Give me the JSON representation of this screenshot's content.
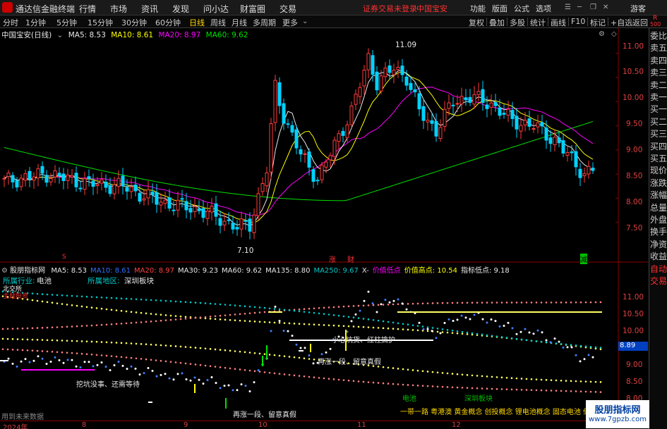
{
  "app": {
    "title": "通达信金融终端",
    "menu": [
      "行情",
      "市场",
      "资讯",
      "发现",
      "问小达",
      "财富圈",
      "交易"
    ],
    "warning": "证券交易未登录",
    "stock_name": "中国宝安",
    "right_menu": [
      "功能",
      "版面",
      "公式",
      "选项"
    ],
    "user": "游客"
  },
  "toolbar": {
    "periods": [
      "分时",
      "1分钟",
      "5分钟",
      "15分钟",
      "30分钟",
      "60分钟",
      "日线",
      "周线",
      "月线",
      "多周期",
      "更多"
    ],
    "active": "日线",
    "right": [
      "复权",
      "叠加",
      "多股",
      "统计",
      "画线",
      "F10",
      "标记",
      "+自选",
      "返回"
    ]
  },
  "main_chart": {
    "title": "中国宝安(日线)",
    "ma": [
      {
        "label": "MA5: 8.53",
        "color": "#e8e8e8"
      },
      {
        "label": "MA10: 8.61",
        "color": "#ffff00"
      },
      {
        "label": "MA20: 8.97",
        "color": "#ff00ff"
      },
      {
        "label": "MA60: 9.62",
        "color": "#00e000"
      }
    ],
    "high_label": "11.09",
    "low_label": "7.10",
    "markers": [
      "S",
      "涨",
      "财",
      "减"
    ]
  },
  "chart_data": {
    "type": "candlestick",
    "ylim": [
      7.0,
      11.3
    ],
    "yticks": [
      11.0,
      10.5,
      10.0,
      9.5,
      9.0,
      8.5,
      8.0,
      7.5
    ],
    "ytick_labels": [
      "11.00",
      "10.50",
      "10.00",
      "9.50",
      "9.00",
      "8.50",
      "8.00",
      "7.50"
    ],
    "high": 11.09,
    "low": 7.1,
    "ma_last": {
      "MA5": 8.53,
      "MA10": 8.61,
      "MA20": 8.97,
      "MA60": 9.62
    }
  },
  "sub_chart": {
    "title": "股朋指标网",
    "items": [
      {
        "label": "MA5: 8.53",
        "color": "#e8e8e8"
      },
      {
        "label": "MA10: 8.61",
        "color": "#3070ff"
      },
      {
        "label": "MA20: 8.97",
        "color": "#ff4040"
      },
      {
        "label": "MA30: 9.23",
        "color": "#e8e8e8"
      },
      {
        "label": "MA60: 9.62",
        "color": "#e8e8e8"
      },
      {
        "label": "MA135: 8.80",
        "color": "#e8e8e8"
      },
      {
        "label": "MA250: 9.67",
        "color": "#00c8c8"
      },
      {
        "label": "X-",
        "color": "#e8e8e8"
      },
      {
        "label": "价值低点",
        "color": "#ff00ff"
      },
      {
        "label": "价值高点: 10.54",
        "color": "#ffff00"
      },
      {
        "label": "指标低点: 9.18",
        "color": "#e8e8e8"
      }
    ],
    "industry_label": "所属行业:",
    "industry": "电池",
    "region_label": "所属地区:",
    "region": "深圳板块",
    "tag1": "北交所",
    "tag2": "主题投资",
    "annotations": [
      "挖坑没事、还需等待",
      "小心坑货、红柱擒护",
      "再涨一段、留意真假",
      "再涨一段、留意真假"
    ],
    "bottom_industry": "电池",
    "bottom_region": "深圳板块",
    "concepts": "一带一路 粤港澳 黄金概念 创投概念 锂电池概念 固态电池 储",
    "footer": "用到未来数据",
    "yticks": [
      "11.00",
      "10.50",
      "10.00",
      "9.50",
      "9.00",
      "8.50",
      "8.00"
    ],
    "value_badge": "8.89"
  },
  "xaxis": {
    "labels": [
      "2024年",
      "8",
      "9",
      "10",
      "11",
      "12"
    ]
  },
  "right_panel": [
    "委比",
    "卖五",
    "卖四",
    "卖三",
    "卖二",
    "卖一",
    "买一",
    "买二",
    "买三",
    "买四",
    "买五",
    "现价",
    "涨跌",
    "涨幅",
    "总量",
    "外盘",
    "换手",
    "净资",
    "收益",
    "自动",
    "交易"
  ],
  "corner": {
    "r": "R",
    "n": "500"
  },
  "watermark": {
    "text": "股朋指标网",
    "url": "www.7gpzb.com"
  }
}
